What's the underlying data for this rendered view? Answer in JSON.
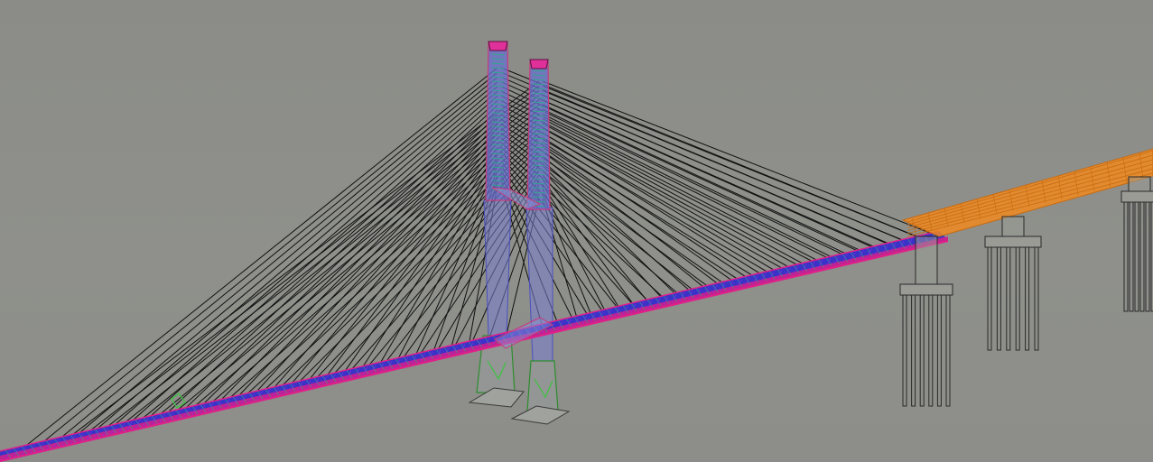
{
  "viewport": {
    "background": "#8e8f8a"
  },
  "colors": {
    "cable": "#101010",
    "deck_main": "#3a33c8",
    "deck_edge": "#e0208a",
    "deck_cross": "#2fa88c",
    "pylon": "#6a6fd0",
    "pylon_edge": "#c83a7a",
    "pylon_base": "#39c43d",
    "foundation_wire": "#2a2a2a",
    "approach_deck": "#f08a1e",
    "approach_edge": "#c86a10"
  }
}
